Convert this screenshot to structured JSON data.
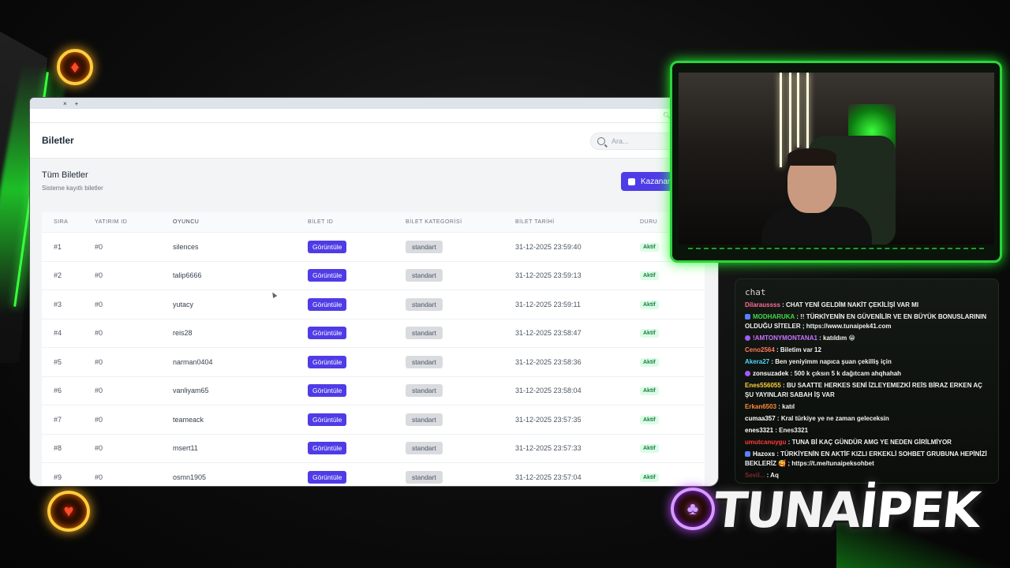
{
  "browser": {
    "tab_close": "×",
    "tab_new": "+",
    "page_title": "Biletler",
    "search_placeholder": "Ara...",
    "section_title": "Tüm Biletler",
    "section_subtitle": "Sisteme kayıtlı biletler",
    "win_button": "Kazanan",
    "columns": [
      "SIRA",
      "YATIRIM ID",
      "OYUNCU",
      "BİLET ID",
      "BİLET KATEGORİSİ",
      "BİLET TARİHİ",
      "DURU"
    ],
    "rows": [
      {
        "sira": "#1",
        "yatirim": "#0",
        "oyuncu": "silences",
        "bilet": "Görüntüle",
        "kategori": "standart",
        "tarih": "31-12-2025 23:59:40",
        "durum": "Aktif"
      },
      {
        "sira": "#2",
        "yatirim": "#0",
        "oyuncu": "talip6666",
        "bilet": "Görüntüle",
        "kategori": "standart",
        "tarih": "31-12-2025 23:59:13",
        "durum": "Aktif"
      },
      {
        "sira": "#3",
        "yatirim": "#0",
        "oyuncu": "yutacy",
        "bilet": "Görüntüle",
        "kategori": "standart",
        "tarih": "31-12-2025 23:59:11",
        "durum": "Aktif"
      },
      {
        "sira": "#4",
        "yatirim": "#0",
        "oyuncu": "reis28",
        "bilet": "Görüntüle",
        "kategori": "standart",
        "tarih": "31-12-2025 23:58:47",
        "durum": "Aktif"
      },
      {
        "sira": "#5",
        "yatirim": "#0",
        "oyuncu": "narman0404",
        "bilet": "Görüntüle",
        "kategori": "standart",
        "tarih": "31-12-2025 23:58:36",
        "durum": "Aktif"
      },
      {
        "sira": "#6",
        "yatirim": "#0",
        "oyuncu": "vanliyam65",
        "bilet": "Görüntüle",
        "kategori": "standart",
        "tarih": "31-12-2025 23:58:04",
        "durum": "Aktif"
      },
      {
        "sira": "#7",
        "yatirim": "#0",
        "oyuncu": "teameack",
        "bilet": "Görüntüle",
        "kategori": "standart",
        "tarih": "31-12-2025 23:57:35",
        "durum": "Aktif"
      },
      {
        "sira": "#8",
        "yatirim": "#0",
        "oyuncu": "msert11",
        "bilet": "Görüntüle",
        "kategori": "standart",
        "tarih": "31-12-2025 23:57:33",
        "durum": "Aktif"
      },
      {
        "sira": "#9",
        "yatirim": "#0",
        "oyuncu": "osmn1905",
        "bilet": "Görüntüle",
        "kategori": "standart",
        "tarih": "31-12-2025 23:57:04",
        "durum": "Aktif"
      }
    ]
  },
  "chat": {
    "title": "chat",
    "messages": [
      {
        "user": "Dilaraussss",
        "color": "#ff6b9a",
        "text": " : CHAT YENİ GELDİM NAKİT ÇEKİLİŞİ VAR MI",
        "tag": ""
      },
      {
        "user": "MODHARUKA",
        "color": "#42d94a",
        "text": " : !! TÜRKİYENİN EN GÜVENİLİR VE EN BÜYÜK BONUSLARININ OLDUĞU SİTELER ; https://www.tunaipek41.com",
        "tag": "b"
      },
      {
        "user": "!AMTONYMONTANA1",
        "color": "#c873ff",
        "text": " : katıldım 😁",
        "tag": "p"
      },
      {
        "user": "Ceno2564",
        "color": "#ff7a5a",
        "text": " : Biletim var 12",
        "tag": ""
      },
      {
        "user": "Akera27",
        "color": "#4fd6ff",
        "text": " : Ben yeniyimm napıca şuan çekilliş için",
        "tag": ""
      },
      {
        "user": "zonsuzadek",
        "color": "#ffffff",
        "text": " : 500 k çıksın 5 k dağıtcam ahqhahah",
        "tag": "p"
      },
      {
        "user": "Enes556055",
        "color": "#ffcf3a",
        "text": " : BU SAATTE HERKES SENİ İZLEYEMEZKİ REİS BİRAZ ERKEN AÇ ŞU YAYINLARI SABAH İŞ VAR",
        "tag": ""
      },
      {
        "user": "Erkan6503",
        "color": "#ff8a3a",
        "text": " : katıl",
        "tag": ""
      },
      {
        "user": "cumaa357",
        "color": "#ffffff",
        "text": " : Kral türkiye ye ne zaman geleceksin",
        "tag": ""
      },
      {
        "user": "enes3321",
        "color": "#ffffff",
        "text": " : Enes3321",
        "tag": ""
      },
      {
        "user": "umutcanuygu",
        "color": "#ff3a3a",
        "text": " : TUNA Bİ KAÇ GÜNDÜR AMG YE NEDEN GİRİLMİYOR",
        "tag": ""
      },
      {
        "user": "Hazoxs",
        "color": "#ffffff",
        "text": " : TÜRKİYENİN EN AKTİF KIZLI ERKEKLİ SOHBET GRUBUNA HEPİNİZİ BEKLERİZ 🥰 ; https://t.me/tunaipeksohbet",
        "tag": "b"
      },
      {
        "user": "Sevil...",
        "color": "#7a2a2a",
        "text": " : Aq",
        "tag": ""
      }
    ]
  },
  "logo": {
    "part1": "TUNA",
    "part2": "İPEK"
  },
  "accent_color": "#2bd33a",
  "primary_button_color": "#4f3ce6"
}
